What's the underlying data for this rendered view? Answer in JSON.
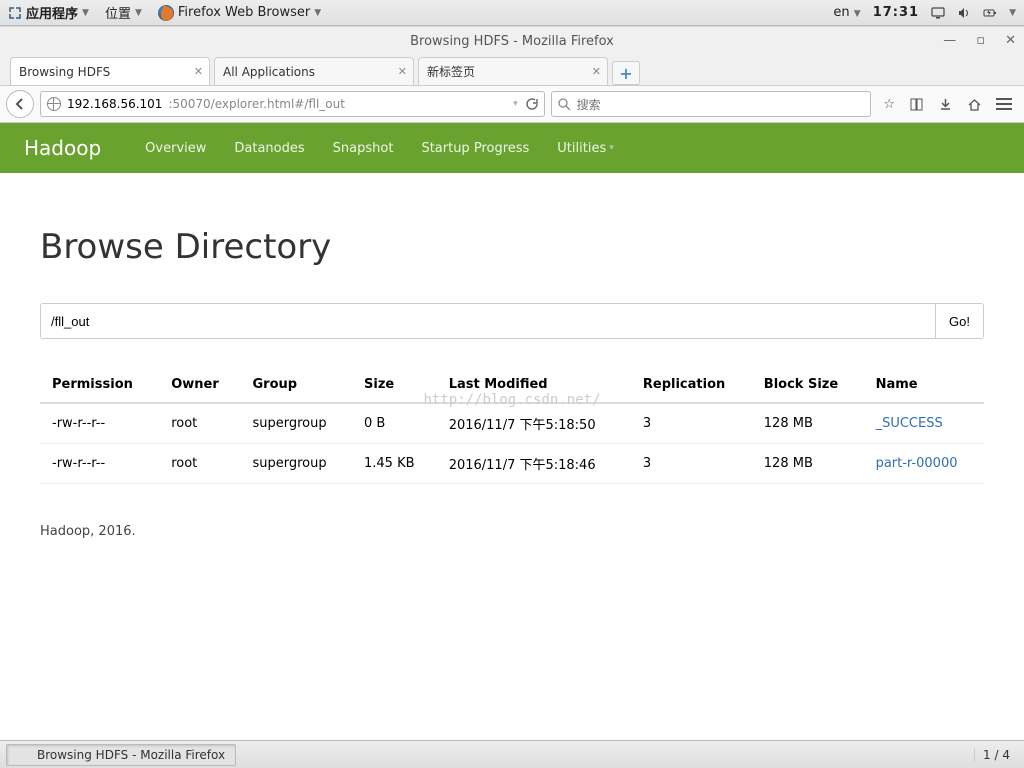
{
  "gnome": {
    "apps_label": "应用程序",
    "places_label": "位置",
    "ff_launcher": "Firefox Web Browser",
    "lang": "en",
    "clock": "17:31"
  },
  "firefox": {
    "window_title": "Browsing HDFS - Mozilla Firefox",
    "tabs": [
      {
        "label": "Browsing HDFS",
        "active": true
      },
      {
        "label": "All Applications",
        "active": false
      },
      {
        "label": "新标签页",
        "active": false
      }
    ],
    "url_host": "192.168.56.101",
    "url_path": ":50070/explorer.html#/fll_out",
    "search_placeholder": "搜索"
  },
  "hadoop": {
    "brand": "Hadoop",
    "nav": {
      "overview": "Overview",
      "datanodes": "Datanodes",
      "snapshot": "Snapshot",
      "startup": "Startup Progress",
      "utilities": "Utilities"
    },
    "heading": "Browse Directory",
    "path_value": "/fll_out",
    "go_label": "Go!",
    "columns": {
      "permission": "Permission",
      "owner": "Owner",
      "group": "Group",
      "size": "Size",
      "last_modified": "Last Modified",
      "replication": "Replication",
      "block_size": "Block Size",
      "name": "Name"
    },
    "rows": [
      {
        "permission": "-rw-r--r--",
        "owner": "root",
        "group": "supergroup",
        "size": "0 B",
        "last_modified": "2016/11/7 下午5:18:50",
        "replication": "3",
        "block_size": "128 MB",
        "name": "_SUCCESS"
      },
      {
        "permission": "-rw-r--r--",
        "owner": "root",
        "group": "supergroup",
        "size": "1.45 KB",
        "last_modified": "2016/11/7 下午5:18:46",
        "replication": "3",
        "block_size": "128 MB",
        "name": "part-r-00000"
      }
    ],
    "footer": "Hadoop, 2016."
  },
  "watermark": "http://blog.csdn.net/",
  "taskbar": {
    "item": "Browsing HDFS - Mozilla Firefox",
    "workspace": "1 / 4"
  }
}
